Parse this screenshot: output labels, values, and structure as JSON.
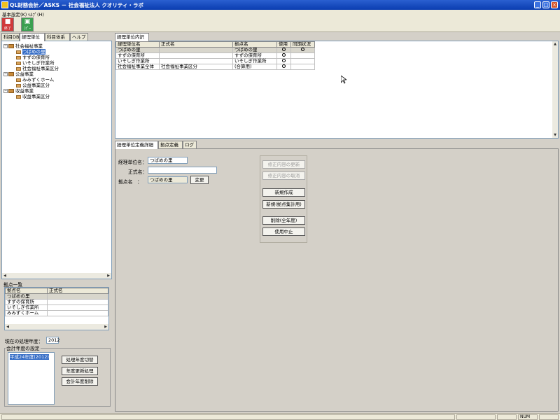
{
  "window": {
    "title": "QL財務会計／ASKS － 社会福祉法人 クオリティ・ラボ",
    "controls": [
      "_",
      "□",
      "×"
    ]
  },
  "menu": [
    "基本設定(K)",
    "ﾍﾙﾌﾟ(H)"
  ],
  "toolbar": {
    "end_label": "終了",
    "copy_label": "ｺﾋﾟｰ"
  },
  "left_tabs": [
    "科目DB",
    "経理単位",
    "科目体系",
    "ヘルプ"
  ],
  "tree": [
    {
      "label": "社会福祉事業",
      "level": 0,
      "type": "folder",
      "expanded": true
    },
    {
      "label": "つばめの里",
      "level": 1,
      "type": "doc",
      "selected": true
    },
    {
      "label": "すずの保育所",
      "level": 1,
      "type": "doc"
    },
    {
      "label": "いそしぎ作業所",
      "level": 1,
      "type": "doc"
    },
    {
      "label": "社会福祉事業区分",
      "level": 1,
      "type": "doc"
    },
    {
      "label": "公益事業",
      "level": 0,
      "type": "folder",
      "expanded": true
    },
    {
      "label": "みみずくホーム",
      "level": 1,
      "type": "doc"
    },
    {
      "label": "公益事業区分",
      "level": 1,
      "type": "doc"
    },
    {
      "label": "収益事業",
      "level": 0,
      "type": "folder",
      "expanded": true
    },
    {
      "label": "収益事業区分",
      "level": 1,
      "type": "doc"
    }
  ],
  "base_list": {
    "title": "拠点一覧",
    "columns": [
      "拠点名",
      "正式名"
    ],
    "rows": [
      [
        "つばめの里",
        ""
      ],
      [
        "すずの保育所",
        ""
      ],
      [
        "いそしぎ作業所",
        ""
      ],
      [
        "みみずくホーム",
        ""
      ]
    ]
  },
  "fiscal": {
    "current_label": "現在の処理年度：",
    "current_year": "2012",
    "group_title": "会計年度の設定",
    "years": [
      "平成24年度(2012)"
    ],
    "switch_btn": "処理年度切替",
    "update_btn": "年度更新処理",
    "delete_btn": "会計年度削除"
  },
  "detail_tabs": [
    "経理単位内訳"
  ],
  "detail_table": {
    "columns": [
      "経理単位名",
      "正式名",
      "拠点名",
      "使用",
      "同期状況"
    ],
    "rows": [
      {
        "name": "つばめの里",
        "formal": "",
        "base": "つばめの里",
        "use": true,
        "sync": true
      },
      {
        "name": "すずの保育所",
        "formal": "",
        "base": "すずの保育所",
        "use": true,
        "sync": false
      },
      {
        "name": "いそしぎ作業所",
        "formal": "",
        "base": "いそしぎ作業所",
        "use": true,
        "sync": false
      },
      {
        "name": "社会福祉事業全体",
        "formal": "社会福祉事業区分",
        "base": "(合算用)",
        "use": true,
        "sync": false
      }
    ]
  },
  "bottom_tabs": [
    "経理単位定義詳細",
    "拠点定義",
    "ログ"
  ],
  "form": {
    "unit_name_label": "経理単位名：",
    "unit_name_value": "つばめの里",
    "formal_label": "正式名：",
    "formal_value": "",
    "base_label": "拠点名　：",
    "base_value": "つばめの里",
    "change_btn": "変更"
  },
  "actions": {
    "update_btn": "修正内容の更新",
    "cancel_btn": "修正内容の取消",
    "new_btn": "新規作成",
    "new_agg_btn": "新規(拠点集計用)",
    "delete_btn": "削除(全年度)",
    "stop_btn": "使用中止"
  },
  "status": {
    "num": "NUM"
  },
  "colors": {
    "titlebar": "#0a3db0",
    "selection": "#316ac5",
    "end_button": "#d03a3a",
    "copy_button": "#3aa050"
  }
}
